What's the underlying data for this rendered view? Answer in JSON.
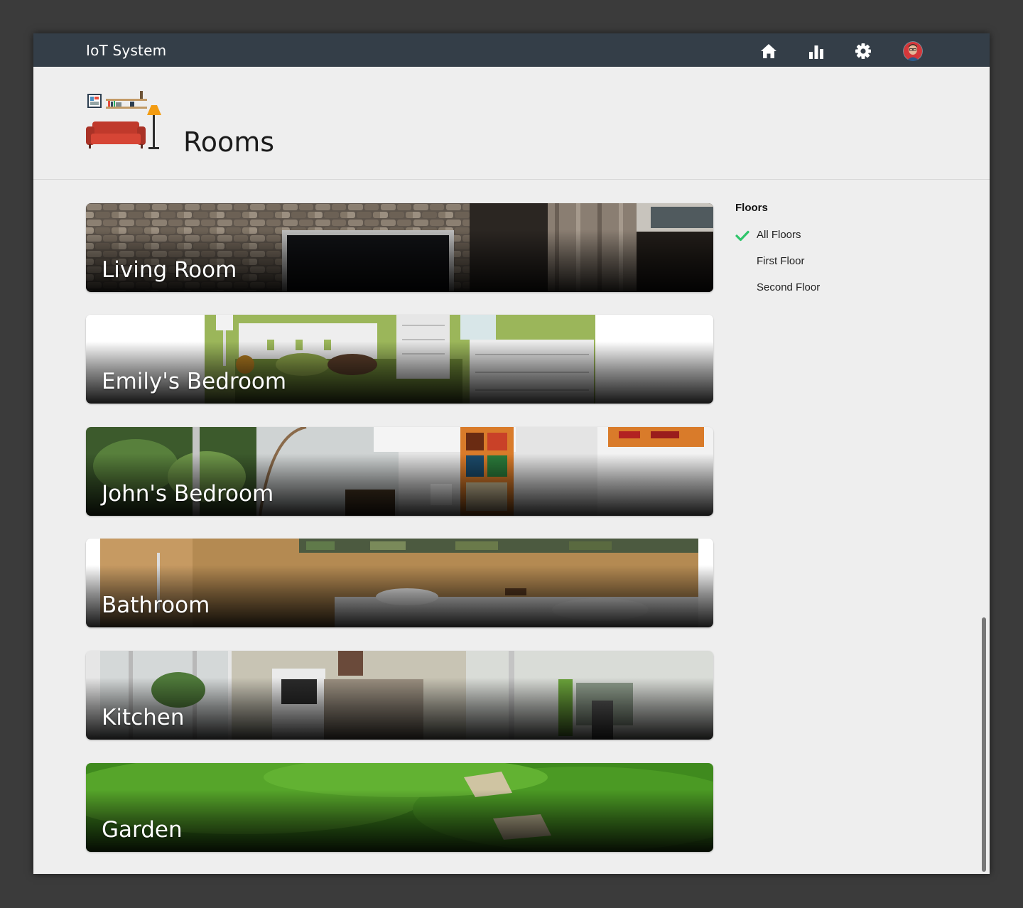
{
  "app": {
    "title": "IoT System"
  },
  "nav": {
    "items": [
      {
        "icon": "home-icon"
      },
      {
        "icon": "bar-chart-icon"
      },
      {
        "icon": "gear-icon"
      },
      {
        "icon": "user-avatar"
      }
    ]
  },
  "page": {
    "title": "Rooms",
    "illustration": "living-room-illustration"
  },
  "rooms": [
    {
      "name": "Living Room"
    },
    {
      "name": "Emily's Bedroom"
    },
    {
      "name": "John's Bedroom"
    },
    {
      "name": "Bathroom"
    },
    {
      "name": "Kitchen"
    },
    {
      "name": "Garden"
    }
  ],
  "floors": {
    "title": "Floors",
    "items": [
      {
        "label": "All Floors",
        "selected": true
      },
      {
        "label": "First Floor",
        "selected": false
      },
      {
        "label": "Second Floor",
        "selected": false
      }
    ]
  },
  "colors": {
    "topbar": "#343e48",
    "background": "#eeeeee",
    "check": "#2fc56b",
    "frame": "#3b3b3b"
  }
}
